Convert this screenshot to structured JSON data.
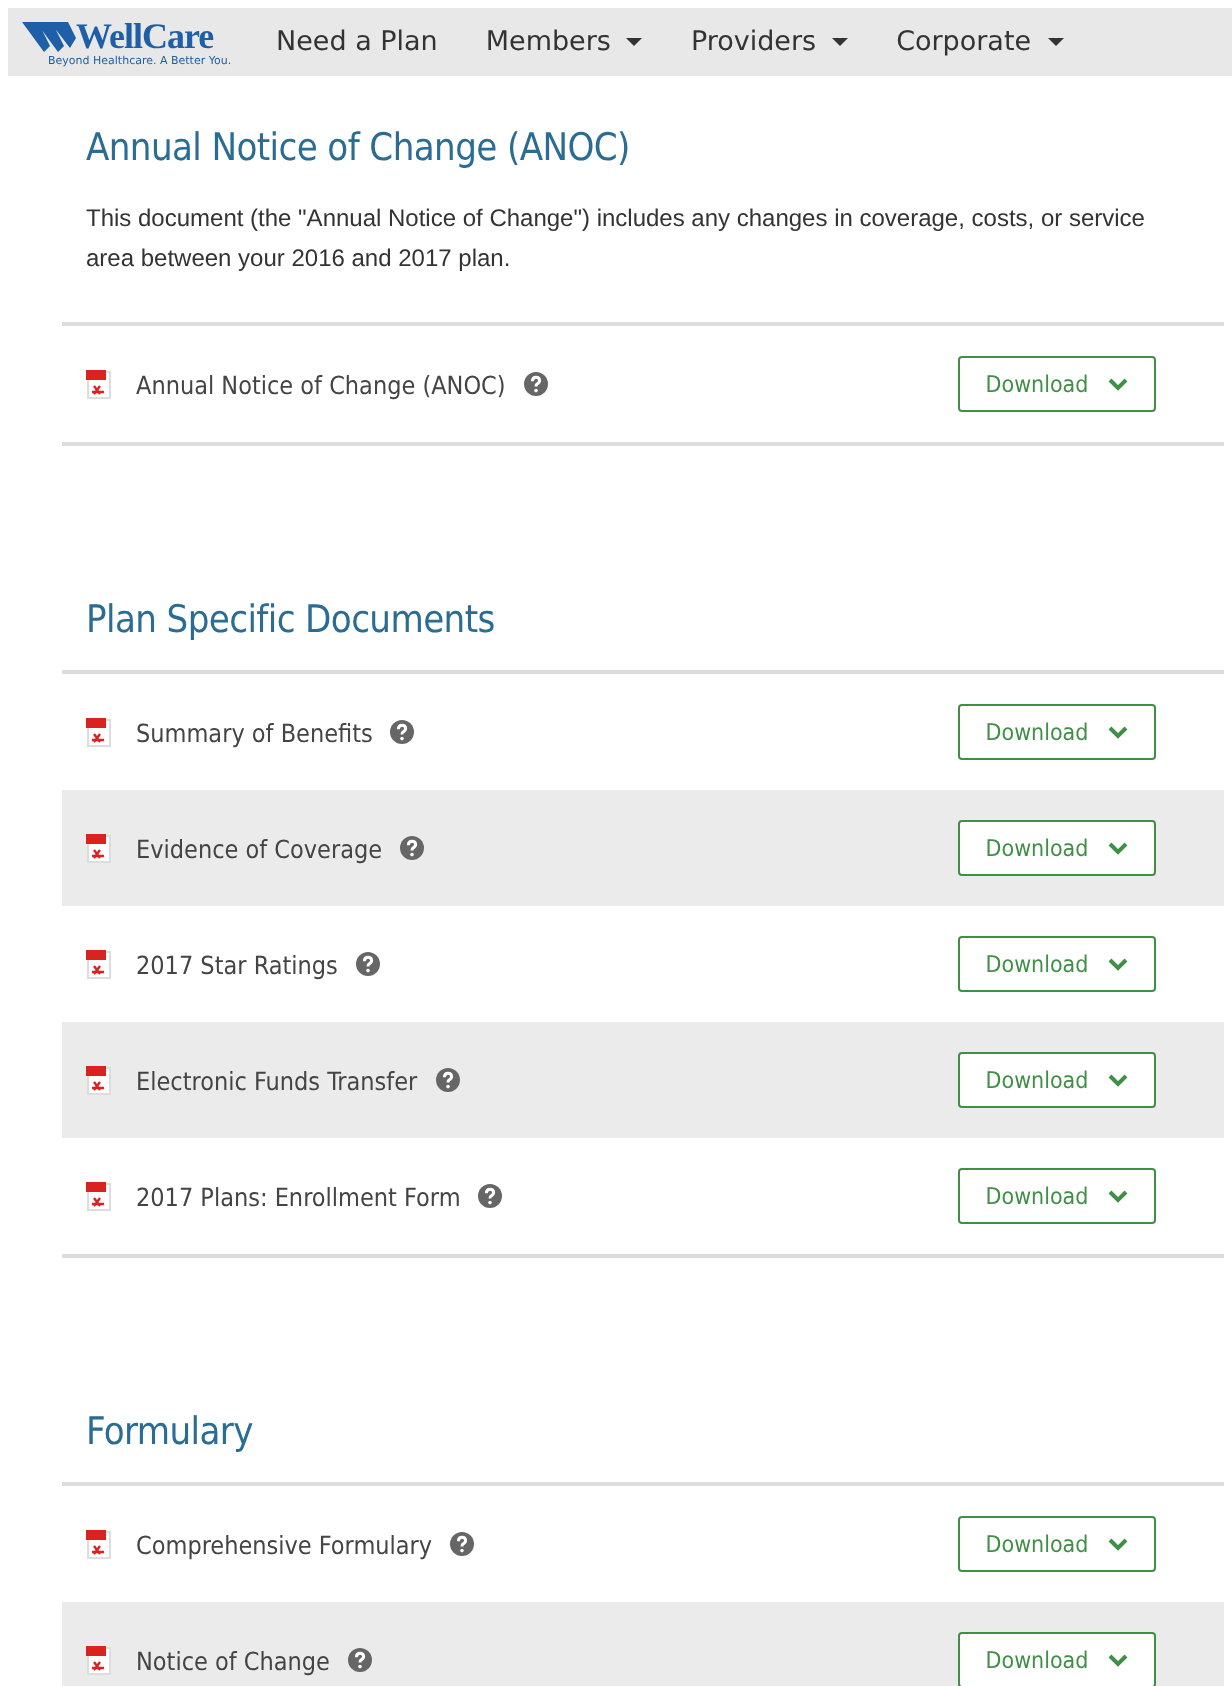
{
  "nav": {
    "logo": {
      "name": "WellCare",
      "tagline": "Beyond Healthcare. A Better You."
    },
    "items": [
      {
        "label": "Need a Plan",
        "has_menu": false
      },
      {
        "label": "Members",
        "has_menu": true
      },
      {
        "label": "Providers",
        "has_menu": true
      },
      {
        "label": "Corporate",
        "has_menu": true
      }
    ]
  },
  "sections": [
    {
      "title": "Annual Notice of Change (ANOC)",
      "description": "This document (the \"Annual Notice of Change\") includes any changes in coverage, costs, or service area between your 2016 and 2017 plan.",
      "documents": [
        {
          "name": "Annual Notice of Change (ANOC)",
          "button": "Download"
        }
      ]
    },
    {
      "title": "Plan Specific Documents",
      "documents": [
        {
          "name": "Summary of Benefits",
          "button": "Download"
        },
        {
          "name": "Evidence of Coverage",
          "button": "Download"
        },
        {
          "name": "2017 Star Ratings",
          "button": "Download"
        },
        {
          "name": "Electronic Funds Transfer",
          "button": "Download"
        },
        {
          "name": "2017 Plans: Enrollment Form",
          "button": "Download"
        }
      ]
    },
    {
      "title": "Formulary",
      "documents": [
        {
          "name": "Comprehensive Formulary",
          "button": "Download"
        },
        {
          "name": "Notice of Change",
          "button": "Download"
        }
      ]
    }
  ]
}
